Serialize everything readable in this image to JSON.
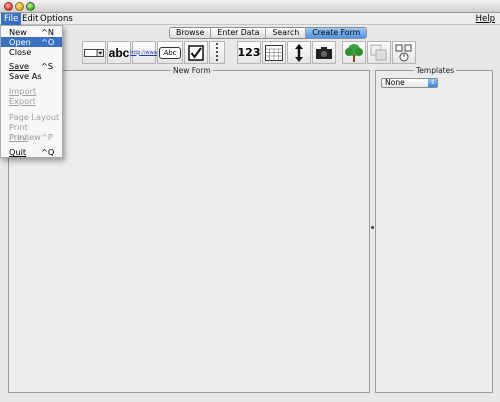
{
  "menubar": {
    "file": "File",
    "edit": "Edit",
    "options": "Options",
    "help": "Help"
  },
  "file_menu": {
    "items": [
      {
        "label": "New",
        "shortcut": "^N",
        "state": "normal"
      },
      {
        "label": "Open",
        "shortcut": "^O",
        "state": "selected"
      },
      {
        "label": "Close",
        "shortcut": "",
        "state": "normal"
      },
      {
        "label": "Save",
        "shortcut": "^S",
        "state": "normal"
      },
      {
        "label": "Save As",
        "shortcut": "",
        "state": "normal"
      },
      {
        "label": "Import",
        "shortcut": "",
        "state": "disabled"
      },
      {
        "label": "Export",
        "shortcut": "",
        "state": "disabled"
      },
      {
        "label": "Page Layout",
        "shortcut": "",
        "state": "disabled"
      },
      {
        "label": "Print Preview",
        "shortcut": "",
        "state": "disabled"
      },
      {
        "label": "Print",
        "shortcut": "^P",
        "state": "disabled"
      },
      {
        "label": "Quit",
        "shortcut": "^Q",
        "state": "normal"
      }
    ]
  },
  "tabs": [
    "Browse",
    "Enter Data",
    "Search",
    "Create Form"
  ],
  "active_tab": "Create Form",
  "toolbar": {
    "text_label_tool": "abc",
    "url_tool": "http://www",
    "text_area_tool": "Abc",
    "number_tool": "123",
    "icons": [
      "dropdown-field-icon",
      "text-label-icon",
      "url-field-icon",
      "text-area-icon",
      "checkbox-icon",
      "divider-icon",
      "number-field-icon",
      "calendar-icon",
      "vertical-arrow-icon",
      "camera-icon",
      "tree-icon",
      "duplicate-icon",
      "help-cursor-icon"
    ]
  },
  "panels": {
    "new_form_title": "New Form",
    "templates_title": "Templates",
    "template_selected": "None"
  },
  "colors": {
    "menu_highlight": "#3a6fc2",
    "active_tab": "#4b93e4",
    "window_bg": "#e8e8e8"
  }
}
